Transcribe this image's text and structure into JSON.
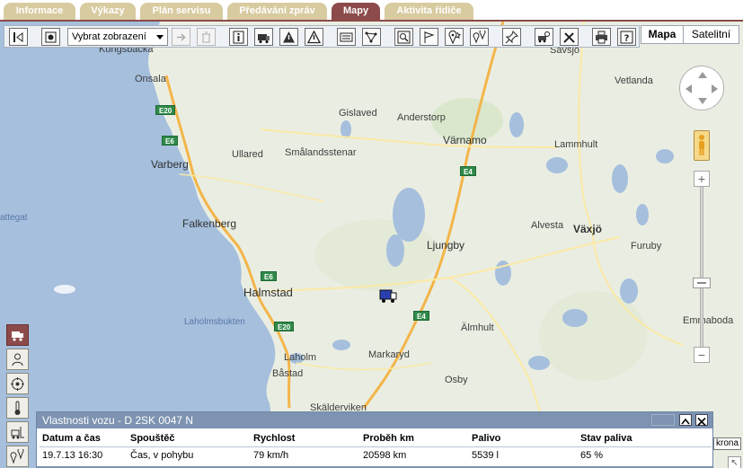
{
  "tabs": [
    {
      "label": "Informace",
      "active": false
    },
    {
      "label": "Výkazy",
      "active": false
    },
    {
      "label": "Plán servisu",
      "active": false
    },
    {
      "label": "Předávání zpráv",
      "active": false
    },
    {
      "label": "Mapy",
      "active": true
    },
    {
      "label": "Aktivita řidiče",
      "active": false
    }
  ],
  "toolbar": {
    "view_select": "Vybrat zobrazení",
    "icons": [
      "layer-toggle-icon",
      "settings-icon",
      "forward-icon",
      "trash-icon",
      "info-icon",
      "vehicle-icon",
      "warning-icon",
      "alert-outline-icon",
      "list-icon",
      "network-icon",
      "zoom-area-icon",
      "flag-icon",
      "poi-icon",
      "route-icon",
      "pin-icon",
      "vehicle-search-icon",
      "tools-icon",
      "print-icon",
      "help-icon"
    ]
  },
  "map_type": {
    "map": "Mapa",
    "satellite": "Satelitní"
  },
  "map_labels": {
    "onsala": "Onsala",
    "kungsbacka": "Kungsbacka",
    "varberg": "Varberg",
    "falkenberg": "Falkenberg",
    "halmstad": "Halmstad",
    "laholm": "Laholm",
    "bastad": "Båstad",
    "skalderviken": "Skälderviken",
    "laholmsbukten": "Laholmsbukten",
    "kattegat": "attegat",
    "ullared": "Ullared",
    "smalandsstenar": "Smålandsstenar",
    "gislaved": "Gislaved",
    "anderstorp": "Anderstorp",
    "varnamo": "Värnamo",
    "ljungby": "Ljungby",
    "markaryd": "Markaryd",
    "osby": "Osby",
    "almhult": "Älmhult",
    "alvesta": "Alvesta",
    "vaxjo": "Växjö",
    "furuby": "Furuby",
    "emmaboda": "Emmaboda",
    "lammhult": "Lammhult",
    "vetlanda": "Vetlanda",
    "savsjo": "Sävsjö"
  },
  "road_shields": {
    "e20": "E20",
    "e6": "E6",
    "e4": "E4"
  },
  "panel": {
    "title": "Vlastnosti vozu - D 2SK 0047 N",
    "columns": [
      "Datum a čas",
      "Spouštěč",
      "Rychlost",
      "Proběh km",
      "Palivo",
      "Stav paliva"
    ],
    "rows": [
      [
        "19.7.13 16:30",
        "Čas, v pohybu",
        "79 km/h",
        "20598 km",
        "5539 l",
        "65 %"
      ]
    ]
  },
  "scale_text": "krona",
  "colors": {
    "accent": "#8c4a4a",
    "tab": "#d8cba0",
    "panel_header": "#7d93b1"
  }
}
